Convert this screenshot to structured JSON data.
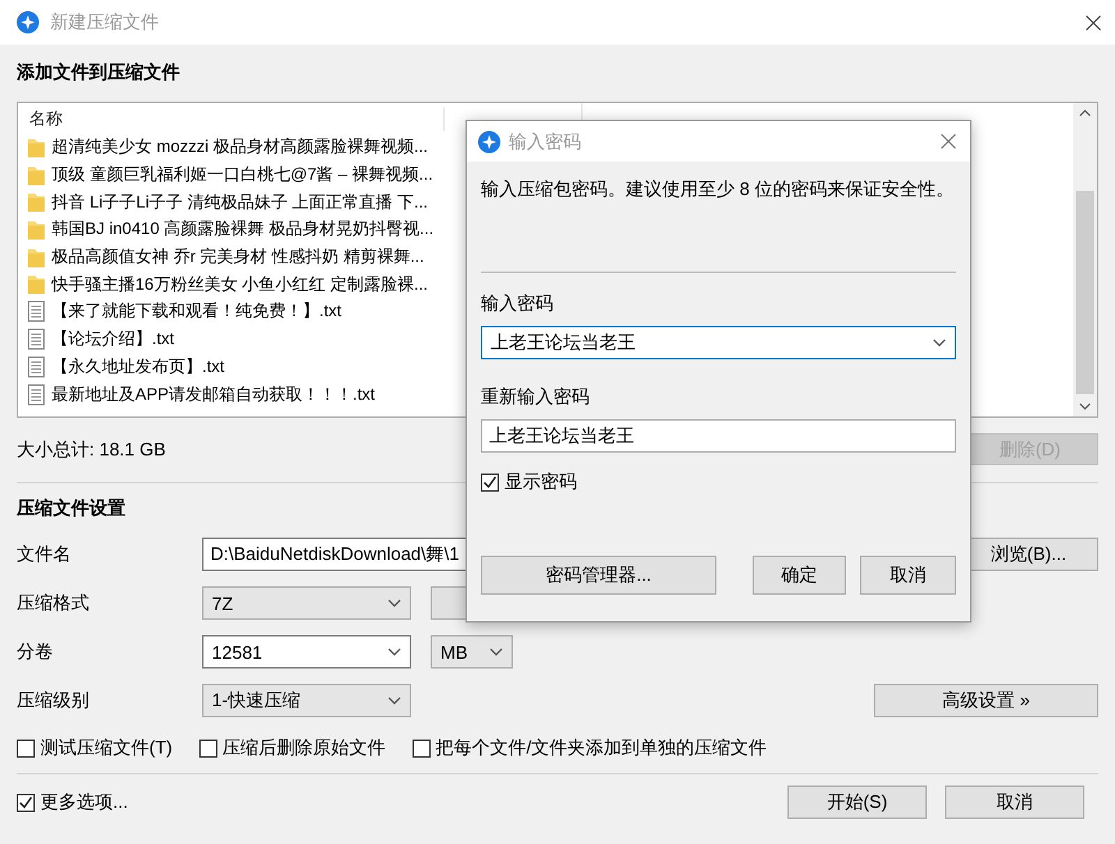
{
  "window": {
    "title": "新建压缩文件"
  },
  "files": {
    "heading": "添加文件到压缩文件",
    "columns": [
      "名称"
    ],
    "rows": [
      {
        "kind": "folder",
        "name": "超清纯美少女 mozzzi 极品身材高颜露脸裸舞视频..."
      },
      {
        "kind": "folder",
        "name": "顶级 童颜巨乳福利姬一口白桃七@7酱 – 裸舞视频..."
      },
      {
        "kind": "folder",
        "name": "抖音 Li子子Li子子 清纯极品妹子 上面正常直播 下..."
      },
      {
        "kind": "folder",
        "name": "韩国BJ in0410 高颜露脸裸舞 极品身材晃奶抖臀视..."
      },
      {
        "kind": "folder",
        "name": "极品高颜值女神 乔r 完美身材 性感抖奶 精剪裸舞..."
      },
      {
        "kind": "folder",
        "name": "快手骚主播16万粉丝美女 小鱼小红红 定制露脸裸..."
      },
      {
        "kind": "text",
        "name": "【来了就能下载和观看！纯免费！】.txt"
      },
      {
        "kind": "text",
        "name": "【论坛介绍】.txt"
      },
      {
        "kind": "text",
        "name": "【永久地址发布页】.txt"
      },
      {
        "kind": "text",
        "name": "最新地址及APP请发邮箱自动获取！！！.txt"
      }
    ],
    "total": "大小总计: 18.1 GB",
    "delete_button": {
      "label": "删除(D)",
      "disabled": true
    }
  },
  "settings": {
    "heading": "压缩文件设置",
    "filename": {
      "label": "文件名",
      "value": "D:\\BaiduNetdiskDownload\\舞\\1"
    },
    "browse_button": "浏览(B)...",
    "format": {
      "label": "压缩格式",
      "value": "7Z"
    },
    "split": {
      "label": "分卷",
      "value": "12581",
      "unit": "MB"
    },
    "level": {
      "label": "压缩级别",
      "value": "1-快速压缩"
    },
    "advanced_button": "高级设置 »",
    "options": [
      {
        "label": "测试压缩文件(T)",
        "checked": false
      },
      {
        "label": "压缩后删除原始文件",
        "checked": false
      },
      {
        "label": "把每个文件/文件夹添加到单独的压缩文件",
        "checked": false
      }
    ]
  },
  "footer": {
    "more_options": {
      "label": "更多选项...",
      "checked": true
    },
    "buttons": [
      "开始(S)",
      "取消"
    ]
  },
  "password_dialog": {
    "title": "输入密码",
    "description": "输入压缩包密码。建议使用至少 8 位的密码来保证安全性。",
    "password": {
      "label": "输入密码",
      "value": "上老王论坛当老王"
    },
    "confirm": {
      "label": "重新输入密码",
      "value": "上老王论坛当老王"
    },
    "show_password": {
      "label": "显示密码",
      "checked": true
    },
    "manager_button": "密码管理器...",
    "buttons": [
      "确定",
      "取消"
    ]
  }
}
